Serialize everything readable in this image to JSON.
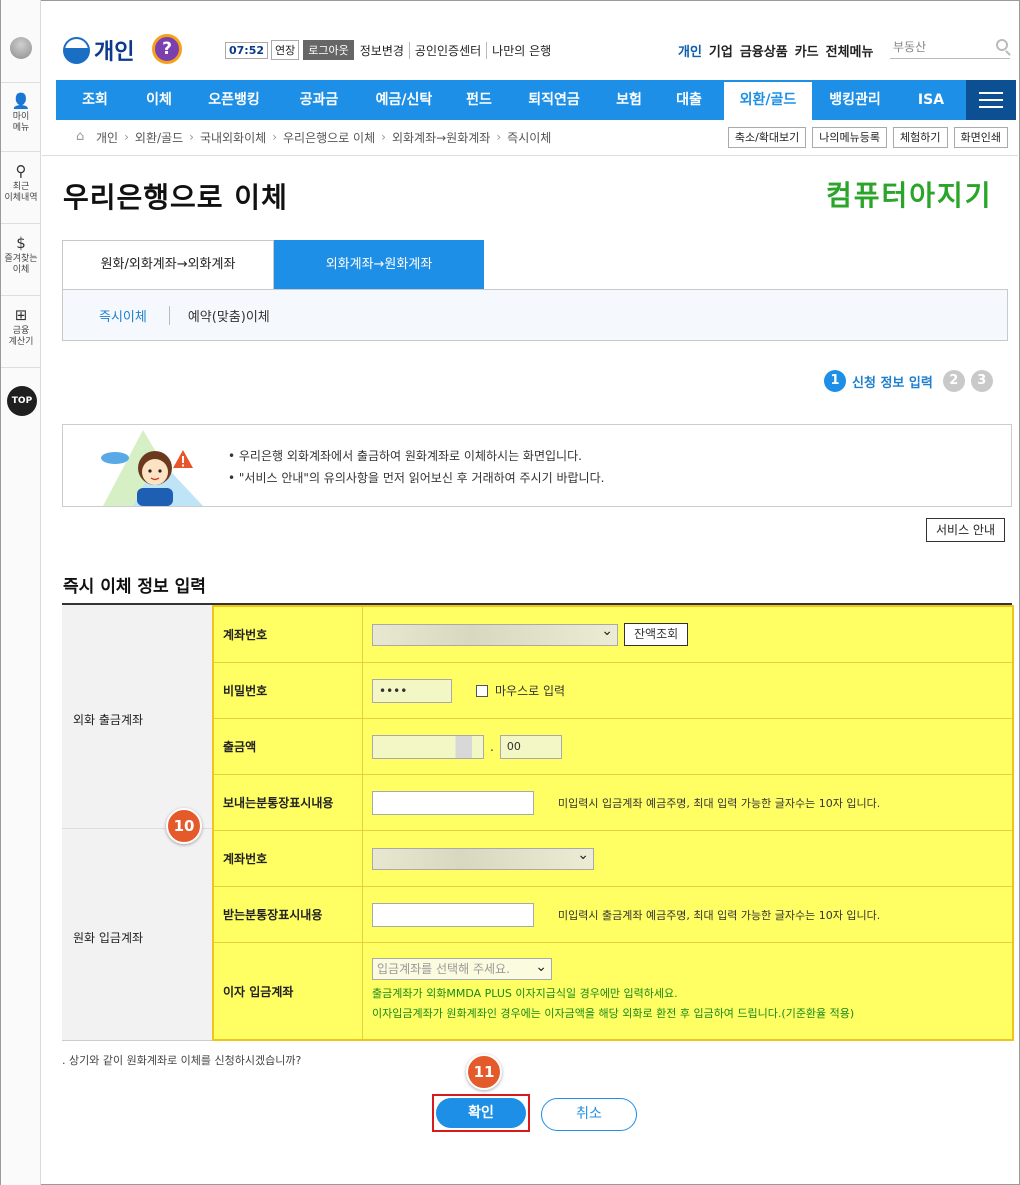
{
  "rail": {
    "items": [
      {
        "label": "마이\n메뉴",
        "icon": "person-icon"
      },
      {
        "label": "최근\n이체내역",
        "icon": "location-icon"
      },
      {
        "label": "즐겨찾는\n이체",
        "icon": "money-bag-icon"
      },
      {
        "label": "금융\n계산기",
        "icon": "calculator-icon"
      }
    ],
    "top_label": "TOP"
  },
  "header": {
    "logo_text": "개인",
    "help_glyph": "?",
    "timer": "07:52",
    "extend": "연장",
    "logout": "로그아웃",
    "util_links": [
      "정보변경",
      "공인인증센터",
      "나만의 은행"
    ],
    "top_right": [
      "개인",
      "기업",
      "금융상품",
      "카드",
      "전체메뉴"
    ],
    "search_placeholder": "부동산"
  },
  "nav": {
    "items": [
      "조회",
      "이체",
      "오픈뱅킹",
      "공과금",
      "예금/신탁",
      "펀드",
      "퇴직연금",
      "보험",
      "대출",
      "외환/골드",
      "뱅킹관리",
      "ISA"
    ],
    "active": "외환/골드"
  },
  "breadcrumb": {
    "items": [
      "개인",
      "외환/골드",
      "국내외화이체",
      "우리은행으로 이체",
      "외화계좌→원화계좌",
      "즉시이체"
    ],
    "buttons": [
      "축소/확대보기",
      "나의메뉴등록",
      "체험하기",
      "화면인쇄"
    ]
  },
  "page": {
    "title": "우리은행으로 이체",
    "brand": "컴퓨터아지기"
  },
  "tabs": [
    "원화/외화계좌→외화계좌",
    "외화계좌→원화계좌"
  ],
  "subtabs": [
    "즉시이체",
    "예약(맞춤)이체"
  ],
  "steps": {
    "current": "1",
    "current_label": "신청 정보 입력",
    "others": [
      "2",
      "3"
    ]
  },
  "notice": {
    "lines": [
      "• 우리은행 외화계좌에서 출금하여 원화계좌로 이체하시는 화면입니다.",
      "• \"서비스 안내\"의 유의사항을 먼저 읽어보신 후 거래하여 주시기 바랍니다."
    ],
    "service_button": "서비스 안내"
  },
  "form": {
    "section_title": "즉시 이체 정보 입력",
    "group_out": "외화 출금계좌",
    "group_in": "원화 입금계좌",
    "rows": {
      "account": "계좌번호",
      "password": "비밀번호",
      "amount": "출금액",
      "sender_memo": "보내는분통장표시내용",
      "in_account": "계좌번호",
      "receiver_memo": "받는분통장표시내용",
      "interest_account": "이자 입금계좌"
    },
    "balance_button": "잔액조회",
    "password_value": "••••",
    "mouse_input": "마우스로 입력",
    "amount_decimal": "00",
    "amount_dot": ".",
    "sender_note": "미입력시 입금계좌 예금주명, 최대 입력 가능한 글자수는 10자 입니다.",
    "receiver_note": "미입력시 출금계좌 예금주명, 최대 입력 가능한 글자수는 10자 입니다.",
    "interest_placeholder": "입금계좌를 선택해 주세요.",
    "interest_note_1": "출금계좌가 외화MMDA PLUS 이자지급식일 경우에만 입력하세요.",
    "interest_note_2": "이자입금계좌가 원화계좌인 경우에는 이자금액을 해당 외화로 환전 후 입금하여 드립니다.(기준환율 적용)"
  },
  "badges": {
    "form_badge": "10",
    "confirm_badge": "11"
  },
  "confirm": {
    "question": ". 상기와 같이 원화계좌로 이체를 신청하시겠습니까?",
    "ok": "확인",
    "cancel": "취소"
  },
  "colors": {
    "primary": "#1d8fe6",
    "highlight": "#ffff64",
    "badge": "#e55a2a",
    "focus_border": "#d81a1a"
  }
}
